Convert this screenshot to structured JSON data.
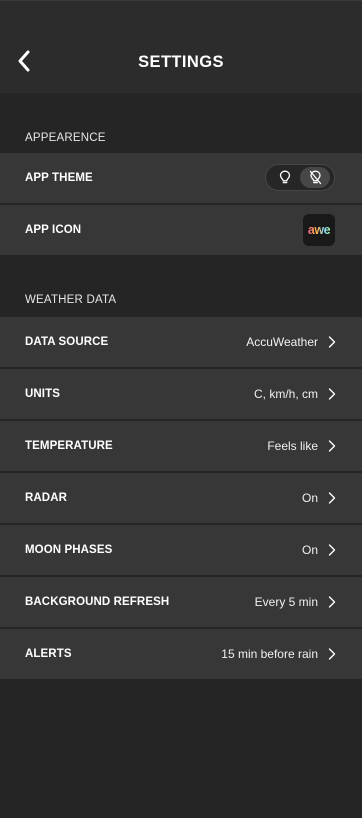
{
  "header": {
    "title": "SETTINGS"
  },
  "sections": {
    "appearance": {
      "title": "APPEARENCE",
      "app_theme_label": "APP THEME",
      "app_icon_label": "APP ICON",
      "app_icon_text": "awe",
      "theme_selected": "dark"
    },
    "weather": {
      "title": "WEATHER DATA",
      "rows": [
        {
          "label": "DATA SOURCE",
          "value": "AccuWeather"
        },
        {
          "label": "UNITS",
          "value": "C, km/h, cm"
        },
        {
          "label": "TEMPERATURE",
          "value": "Feels like"
        },
        {
          "label": "RADAR",
          "value": "On"
        },
        {
          "label": "MOON PHASES",
          "value": "On"
        },
        {
          "label": "BACKGROUND REFRESH",
          "value": "Every 5 min"
        },
        {
          "label": "ALERTS",
          "value": "15 min before rain"
        }
      ]
    }
  },
  "icons": {
    "back": "chevron-left-icon",
    "light_theme": "lightbulb-icon",
    "dark_theme": "lightbulb-off-icon",
    "row_chevron": "chevron-right-icon"
  },
  "colors": {
    "background": "#252525",
    "header": "#2c2c2c",
    "row": "#373737",
    "text": "#ffffff"
  }
}
